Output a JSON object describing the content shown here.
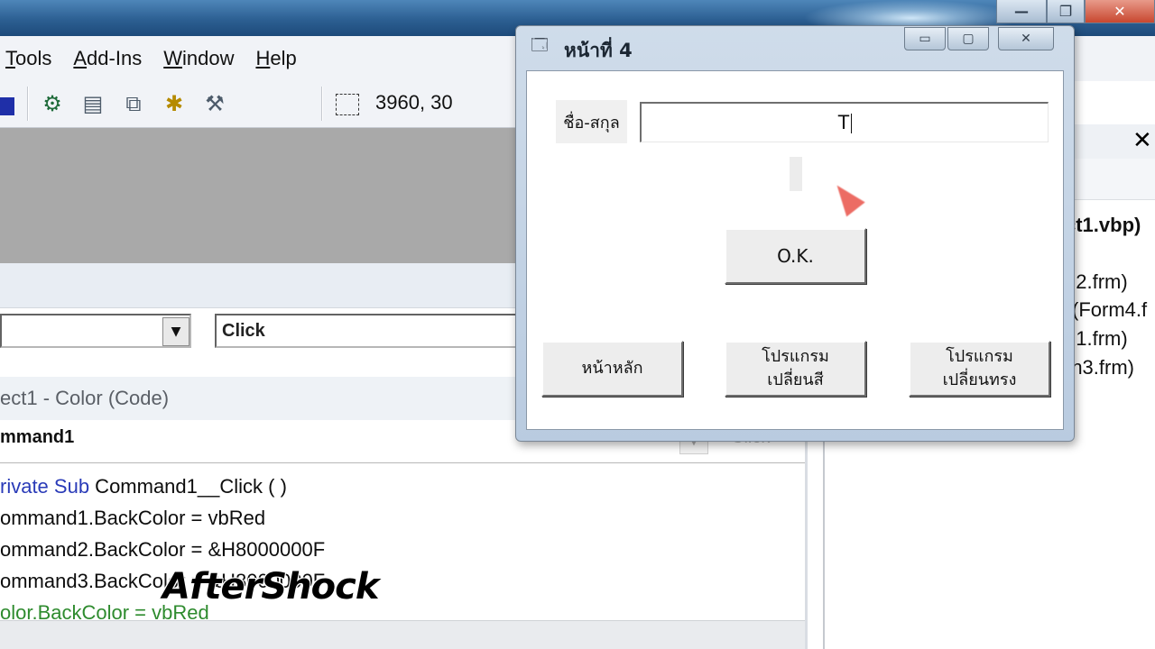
{
  "ide": {
    "menu": [
      {
        "label": "Tools",
        "hotkey": "T",
        "rest": "ools"
      },
      {
        "label": "Add-Ins",
        "hotkey": "A",
        "rest": "dd-Ins"
      },
      {
        "label": "Window",
        "hotkey": "W",
        "rest": "indow"
      },
      {
        "label": "Help",
        "hotkey": "H",
        "rest": "elp"
      }
    ],
    "toolbar": {
      "coords": "3960, 30"
    },
    "proc_combo": "Click",
    "code_window": {
      "title": "ect1 - Color (Code)",
      "object_combo": "mmand1",
      "proc_combo": "Click",
      "lines": [
        {
          "kw": "rivate Sub",
          "text": " Command1__Click ( )"
        },
        {
          "kw": "",
          "text": "ommand1.BackColor = vbRed"
        },
        {
          "kw": "",
          "text": "ommand2.BackColor = &H8000000F"
        },
        {
          "kw": "",
          "text": "ommand3.BackColor = &H8000000F"
        },
        {
          "kw": "",
          "text": "olor.BackColor = vbRed"
        }
      ]
    },
    "watermark": "AfterShock",
    "project_pane": {
      "title": "ct1.vbp)",
      "items": [
        "n2.frm)",
        "(Form4.f",
        "n1.frm)",
        "rn3.frm)"
      ]
    },
    "window_controls": {
      "minimize": "—",
      "restore": "❐",
      "close": "✕"
    },
    "pane_close": "✕"
  },
  "form": {
    "title": "หน้าที่ 4",
    "name_label": "ชื่อ-สกุล",
    "name_value": "T",
    "buttons": {
      "ok": "O.K.",
      "home": "หน้าหลัก",
      "change_color_line1": "โปรแกรม",
      "change_color_line2": "เปลี่ยนสี",
      "change_shape_line1": "โปรแกรม",
      "change_shape_line2": "เปลี่ยนทรง"
    },
    "controls": {
      "minimize": "▭",
      "maximize": "▢",
      "close": "✕"
    }
  },
  "colors": {
    "keyword": "#2a3bb8",
    "comment": "#2e8b2e",
    "cursor": "#e9534a"
  }
}
